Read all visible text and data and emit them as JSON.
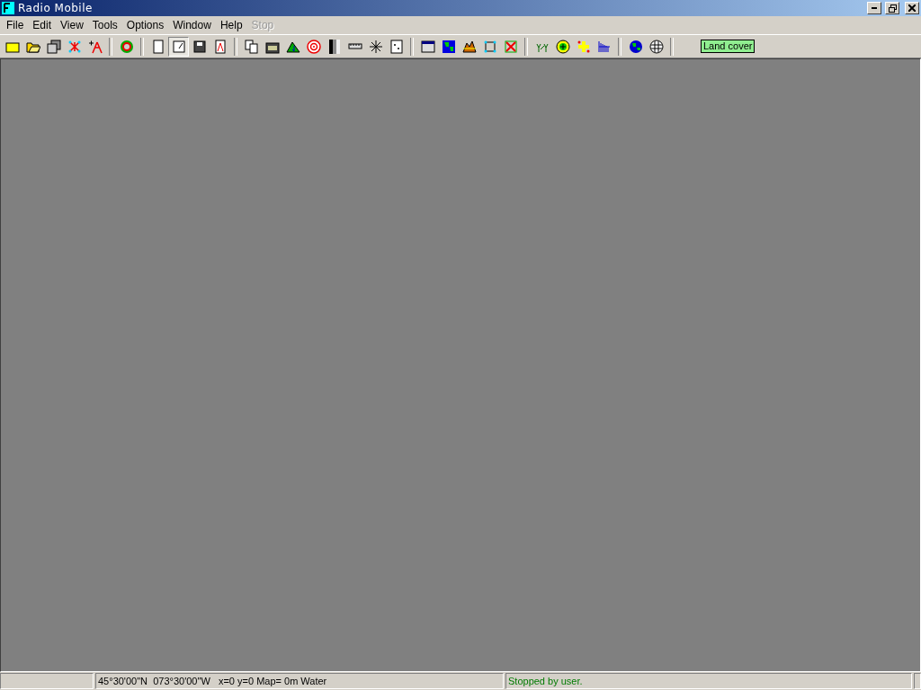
{
  "window": {
    "title": "Radio Mobile"
  },
  "menu": [
    {
      "label": "File",
      "disabled": false
    },
    {
      "label": "Edit",
      "disabled": false
    },
    {
      "label": "View",
      "disabled": false
    },
    {
      "label": "Tools",
      "disabled": false
    },
    {
      "label": "Options",
      "disabled": false
    },
    {
      "label": "Window",
      "disabled": false
    },
    {
      "label": "Help",
      "disabled": false
    },
    {
      "label": "Stop",
      "disabled": true
    }
  ],
  "toolbar": {
    "groups": [
      [
        {
          "pressed": false
        },
        {
          "pressed": false
        },
        {
          "pressed": false
        },
        {
          "pressed": false
        },
        {
          "pressed": false
        }
      ],
      [
        {
          "pressed": false
        }
      ],
      [
        {
          "pressed": false
        },
        {
          "pressed": true
        },
        {
          "pressed": false
        },
        {
          "pressed": false
        }
      ],
      [
        {
          "pressed": false
        },
        {
          "pressed": false
        },
        {
          "pressed": false
        },
        {
          "pressed": false
        },
        {
          "pressed": false
        },
        {
          "pressed": false
        },
        {
          "pressed": false
        },
        {
          "pressed": false
        }
      ],
      [
        {
          "pressed": false
        },
        {
          "pressed": false
        },
        {
          "pressed": false
        },
        {
          "pressed": false
        },
        {
          "pressed": false
        }
      ],
      [
        {
          "pressed": false
        },
        {
          "pressed": false
        },
        {
          "pressed": false
        },
        {
          "pressed": false
        }
      ],
      [
        {
          "pressed": false
        },
        {
          "pressed": false
        }
      ]
    ],
    "badge": "Land cover"
  },
  "status_bar": {
    "position": "45°30'00\"N  073°30'00\"W   x=0 y=0 Map= 0m Water",
    "message": "Stopped by user."
  }
}
